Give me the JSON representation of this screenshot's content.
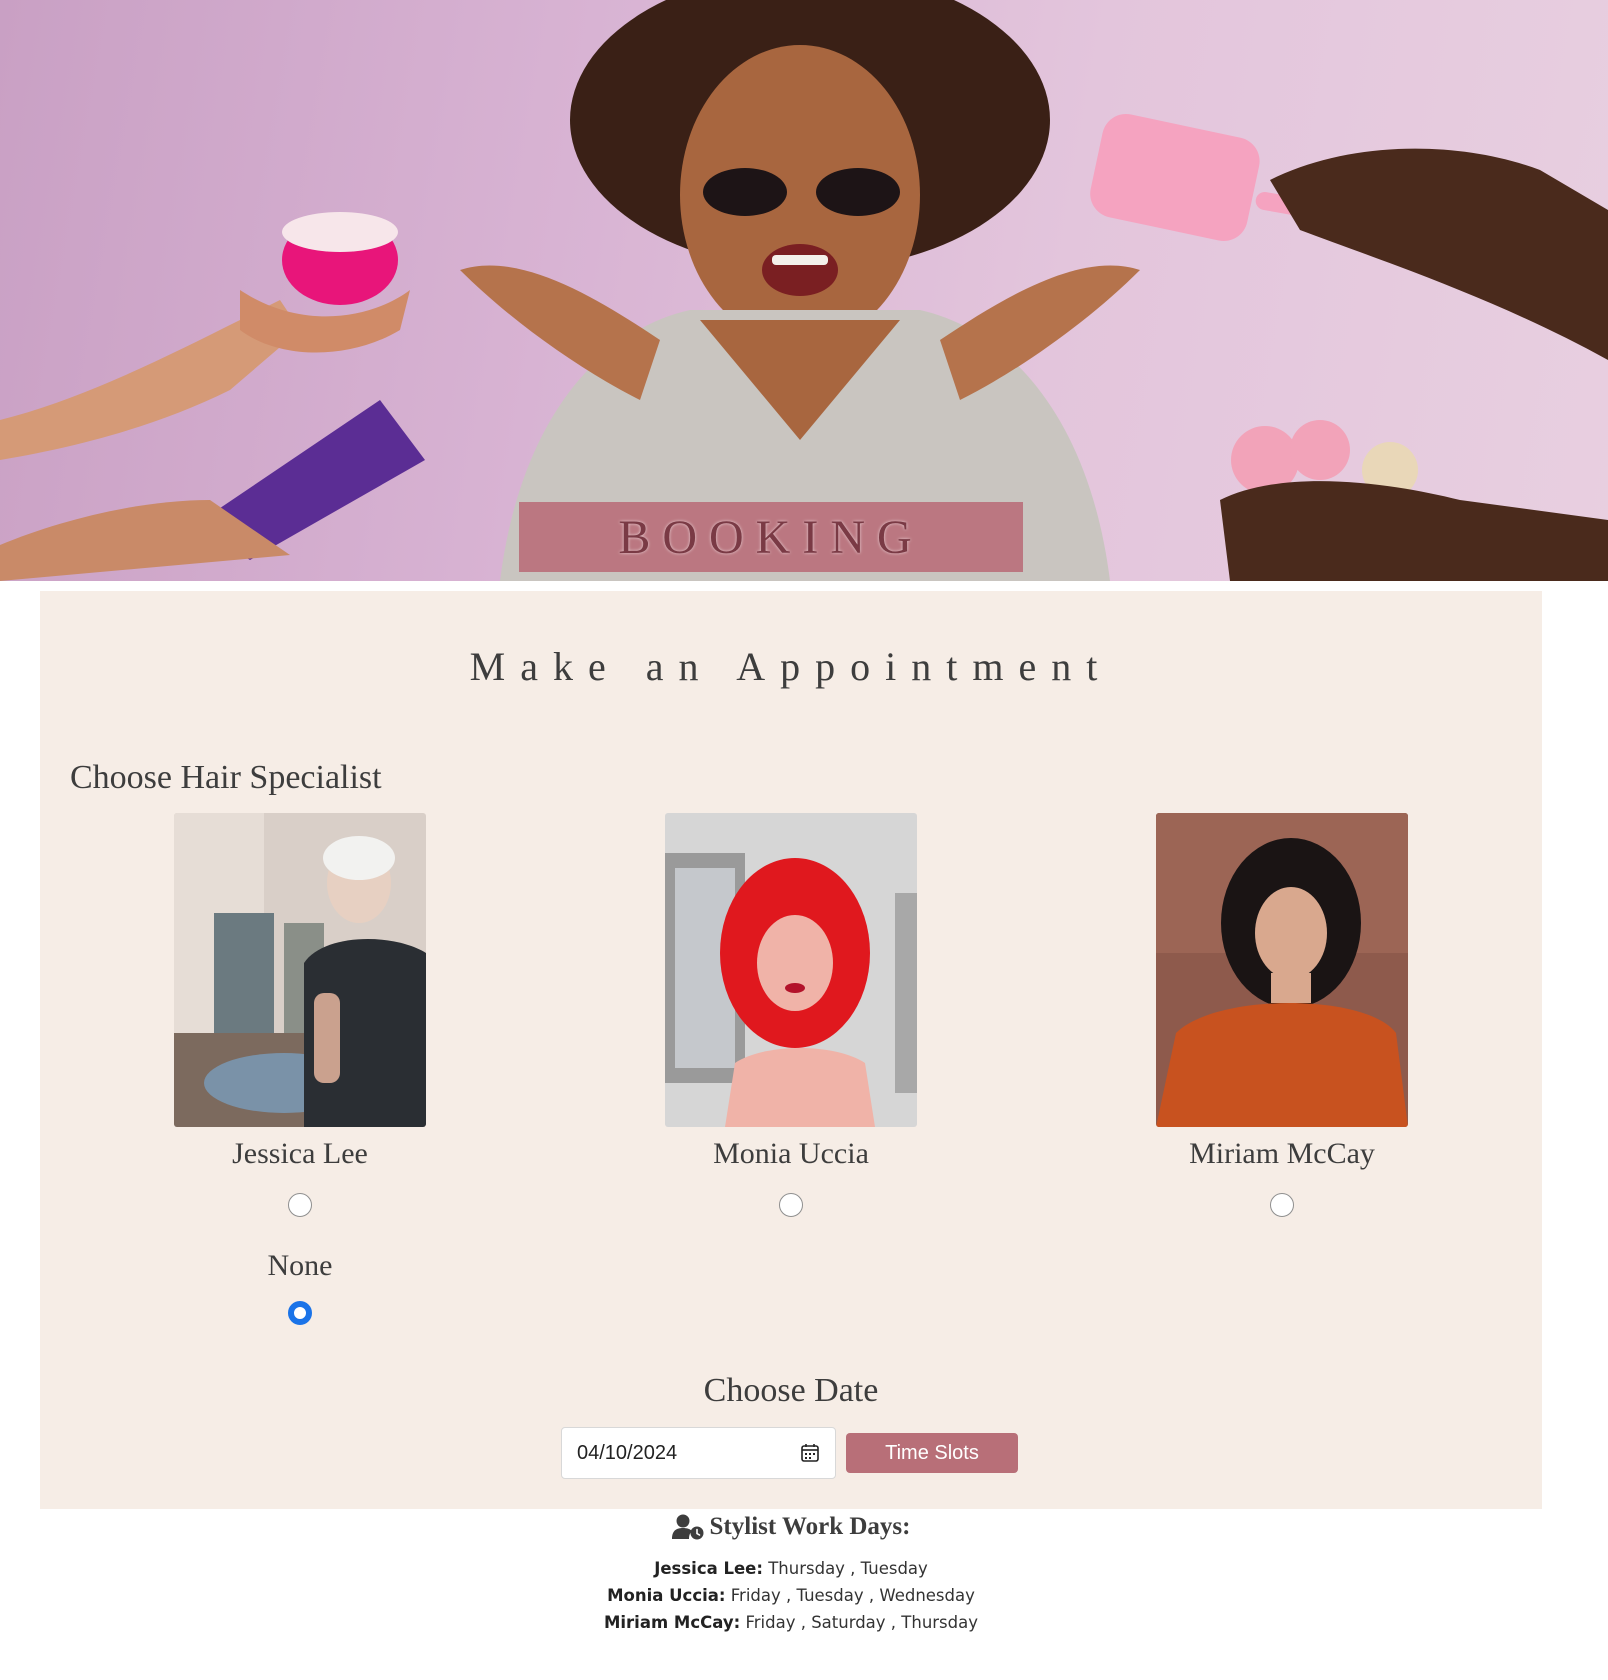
{
  "hero": {
    "banner_text": "BOOKING"
  },
  "panel": {
    "title": "Make an Appointment",
    "specialist_label": "Choose Hair Specialist",
    "stylists": [
      {
        "name": "Jessica Lee",
        "selected": false
      },
      {
        "name": "Monia Uccia",
        "selected": false
      },
      {
        "name": "Miriam McCay",
        "selected": false
      }
    ],
    "none_option": {
      "label": "None",
      "selected": true
    },
    "date_label": "Choose Date",
    "date_value": "04/10/2024",
    "time_slots_label": "Time Slots"
  },
  "workdays": {
    "title": "Stylist Work Days:",
    "icon": "user-clock-icon",
    "entries": [
      {
        "name": "Jessica Lee:",
        "days": "Thursday , Tuesday"
      },
      {
        "name": "Monia Uccia:",
        "days": "Friday , Tuesday , Wednesday"
      },
      {
        "name": "Miriam McCay:",
        "days": "Friday , Saturday , Thursday"
      }
    ]
  },
  "colors": {
    "accent": "#b86f78",
    "panel_bg": "#f6ede6",
    "radio_checked": "#1a73e8"
  }
}
